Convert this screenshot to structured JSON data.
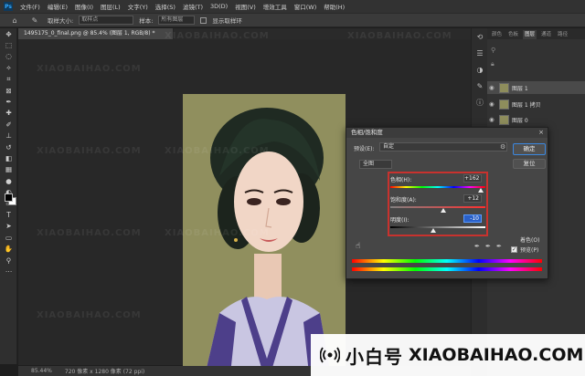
{
  "menu": {
    "app_icon": "Ps",
    "items": [
      "文件(F)",
      "编辑(E)",
      "图像(I)",
      "图层(L)",
      "文字(Y)",
      "选择(S)",
      "滤镜(T)",
      "3D(D)",
      "视图(V)",
      "增效工具",
      "窗口(W)",
      "帮助(H)"
    ]
  },
  "options": {
    "sample_label": "取样大小:",
    "sample_value": "取样点",
    "sample_all_label": "样本:",
    "sample_all_value": "所有图层",
    "show_ring_label": "显示取样环"
  },
  "document": {
    "tab_title": "1495175_0_final.png @ 85.4% (图层 1, RGB/8) *",
    "zoom": "85.44%",
    "dimensions": "720 像素 x 1280 像素 (72 ppi)"
  },
  "watermark": {
    "cn": "小白号",
    "en": "XIAOBAIHAO.COM"
  },
  "right_panel": {
    "tabs": [
      "颜色",
      "色板",
      "图层",
      "通道",
      "路径"
    ],
    "active_tab": "图层",
    "layers": [
      {
        "name": "图层 1",
        "selected": true
      },
      {
        "name": "图层 1 拷贝",
        "selected": false
      },
      {
        "name": "图层 0",
        "selected": false
      }
    ]
  },
  "dialog": {
    "title": "色相/饱和度",
    "close": "×",
    "preset_label": "预设(E):",
    "preset_value": "自定",
    "ok": "确定",
    "reset": "复位",
    "channel": "全图",
    "hue_label": "色相(H):",
    "hue_value": "+162",
    "hue": 162,
    "sat_label": "饱和度(A):",
    "sat_value": "+12",
    "sat": 12,
    "light_label": "明度(I):",
    "light_value": "-10",
    "light": -10,
    "colorize": "着色(O)",
    "preview": "预览(P)",
    "preview_checked": "✓"
  },
  "brand": {
    "name": "小白号",
    "url": "XIAOBAIHAO.COM"
  },
  "colors": {
    "accent_blue": "#3b88e0",
    "highlight_red": "#c8322e",
    "canvas_bg": "#282828"
  }
}
